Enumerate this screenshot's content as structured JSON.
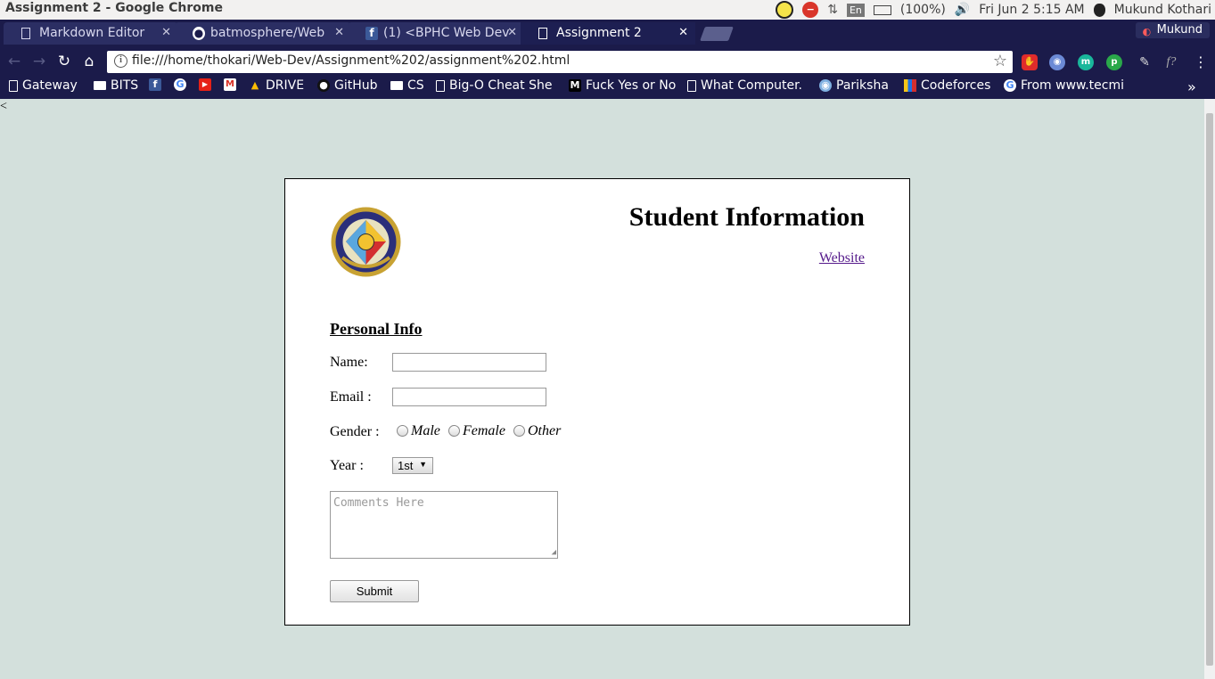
{
  "os": {
    "window_title": "Assignment 2 - Google Chrome",
    "lang": "En",
    "battery": "(100%)",
    "datetime": "Fri Jun  2  5:15 AM",
    "user": "Mukund Kothari"
  },
  "tabs": [
    {
      "label": "Markdown Editor",
      "icon": "page-icon"
    },
    {
      "label": "batmosphere/Web",
      "icon": "github-icon"
    },
    {
      "label": "(1) <BPHC Web Dev",
      "icon": "facebook-icon"
    },
    {
      "label": "Assignment 2",
      "icon": "page-icon",
      "active": true
    }
  ],
  "profile_name": "Mukund",
  "address": {
    "url": "file:///home/thokari/Web-Dev/Assignment%202/assignment%202.html"
  },
  "bookmarks": [
    {
      "label": "Gateway",
      "icon": "page-icon"
    },
    {
      "label": "BITS",
      "icon": "folder-icon"
    },
    {
      "label": "",
      "icon": "facebook-icon"
    },
    {
      "label": "",
      "icon": "google-icon"
    },
    {
      "label": "",
      "icon": "youtube-icon"
    },
    {
      "label": "",
      "icon": "gmail-icon"
    },
    {
      "label": "DRIVE",
      "icon": "drive-icon"
    },
    {
      "label": "GitHub",
      "icon": "github-icon"
    },
    {
      "label": "CS",
      "icon": "folder-icon"
    },
    {
      "label": "Big-O  Cheat She",
      "icon": "page-icon"
    },
    {
      "label": "Fuck Yes or No",
      "icon": "medium-icon"
    },
    {
      "label": "What Computer.",
      "icon": "page-icon"
    },
    {
      "label": "Pariksha",
      "icon": "owl-icon"
    },
    {
      "label": "Codeforces",
      "icon": "codeforces-icon"
    },
    {
      "label": "From www.tecmi",
      "icon": "google-icon"
    }
  ],
  "bookmarks_overflow": "»",
  "page": {
    "stray_text": "<",
    "heading": "Student Information",
    "website_link": "Website",
    "section_title": "Personal Info",
    "name_label": "Name:",
    "email_label": "Email :",
    "gender_label": "Gender :",
    "gender_options": [
      "Male",
      "Female",
      "Other"
    ],
    "year_label": "Year :",
    "year_selected": "1st",
    "comments_placeholder": "Comments Here",
    "submit_label": "Submit"
  }
}
